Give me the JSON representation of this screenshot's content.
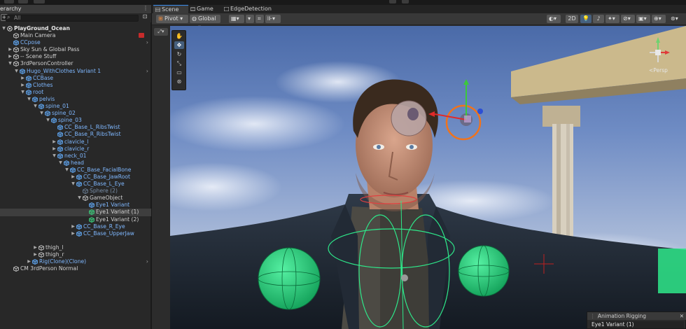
{
  "hierarchy": {
    "title": "erarchy",
    "search_placeholder": "All",
    "items": [
      {
        "label": "PlayGround_Ocean",
        "depth": 0,
        "arrow": "down",
        "kind": "scene"
      },
      {
        "label": "Main Camera",
        "depth": 1,
        "arrow": "none",
        "kind": "plain",
        "flag": true
      },
      {
        "label": "CCpose",
        "depth": 1,
        "arrow": "none",
        "kind": "blue",
        "chev": true
      },
      {
        "label": "Sky Sun & Global Pass",
        "depth": 1,
        "arrow": "right",
        "kind": "plain"
      },
      {
        "label": "-- Scene Stuff",
        "depth": 1,
        "arrow": "right",
        "kind": "plain"
      },
      {
        "label": "3rdPersonController",
        "depth": 1,
        "arrow": "down",
        "kind": "plain"
      },
      {
        "label": "Hugo_WithClothes Variant 1",
        "depth": 2,
        "arrow": "down",
        "kind": "blue",
        "chev": true
      },
      {
        "label": "CCBase",
        "depth": 3,
        "arrow": "right",
        "kind": "blue"
      },
      {
        "label": "Clothes",
        "depth": 3,
        "arrow": "right",
        "kind": "blue"
      },
      {
        "label": "root",
        "depth": 3,
        "arrow": "down",
        "kind": "blue"
      },
      {
        "label": "pelvis",
        "depth": 4,
        "arrow": "down",
        "kind": "blue"
      },
      {
        "label": "spine_01",
        "depth": 5,
        "arrow": "down",
        "kind": "blue"
      },
      {
        "label": "spine_02",
        "depth": 6,
        "arrow": "down",
        "kind": "blue"
      },
      {
        "label": "spine_03",
        "depth": 7,
        "arrow": "down",
        "kind": "blue"
      },
      {
        "label": "CC_Base_L_RibsTwist",
        "depth": 8,
        "arrow": "none",
        "kind": "blue"
      },
      {
        "label": "CC_Base_R_RibsTwist",
        "depth": 8,
        "arrow": "none",
        "kind": "blue"
      },
      {
        "label": "clavicle_l",
        "depth": 8,
        "arrow": "right",
        "kind": "blue"
      },
      {
        "label": "clavicle_r",
        "depth": 8,
        "arrow": "right",
        "kind": "blue"
      },
      {
        "label": "neck_01",
        "depth": 8,
        "arrow": "down",
        "kind": "blue"
      },
      {
        "label": "head",
        "depth": 9,
        "arrow": "down",
        "kind": "blue"
      },
      {
        "label": "CC_Base_FacialBone",
        "depth": 10,
        "arrow": "down",
        "kind": "blue"
      },
      {
        "label": "CC_Base_JawRoot",
        "depth": 11,
        "arrow": "right",
        "kind": "blue"
      },
      {
        "label": "CC_Base_L_Eye",
        "depth": 11,
        "arrow": "down",
        "kind": "blue"
      },
      {
        "label": "Sphere (2)",
        "depth": 12,
        "arrow": "none",
        "kind": "dim"
      },
      {
        "label": "GameObject",
        "depth": 12,
        "arrow": "down",
        "kind": "plain"
      },
      {
        "label": "Eye1 Variant",
        "depth": 13,
        "arrow": "none",
        "kind": "blue"
      },
      {
        "label": "Eye1 Variant (1)",
        "depth": 13,
        "arrow": "none",
        "kind": "plain",
        "selected": true,
        "green": true
      },
      {
        "label": "Eye1 Variant (2)",
        "depth": 13,
        "arrow": "none",
        "kind": "plain",
        "green": true
      },
      {
        "label": "CC_Base_R_Eye",
        "depth": 11,
        "arrow": "right",
        "kind": "blue"
      },
      {
        "label": "CC_Base_UpperJaw",
        "depth": 11,
        "arrow": "right",
        "kind": "blue"
      },
      {
        "label": "",
        "depth": 0,
        "arrow": "none",
        "kind": "spacer"
      },
      {
        "label": "thigh_l",
        "depth": 5,
        "arrow": "right",
        "kind": "plain"
      },
      {
        "label": "thigh_r",
        "depth": 5,
        "arrow": "right",
        "kind": "plain"
      },
      {
        "label": "Rig(Clone)(Clone)",
        "depth": 4,
        "arrow": "right",
        "kind": "blue",
        "chev": true
      },
      {
        "label": "CM 3rdPerson Normal",
        "depth": 1,
        "arrow": "none",
        "kind": "plain"
      }
    ]
  },
  "tabs": [
    {
      "label": "Scene",
      "active": true
    },
    {
      "label": "Game",
      "active": false
    },
    {
      "label": "EdgeDetection",
      "active": false
    }
  ],
  "toolbar": {
    "pivot": "Pivot",
    "global": "Global",
    "mode_2d": "2D"
  },
  "viewport": {
    "persp_label": "<Persp"
  },
  "animation_rigging": {
    "title": "Animation Rigging",
    "value": "Eye1 Variant (1)"
  },
  "colors": {
    "accent": "#3a8ef0",
    "selection": "#3e3e3e",
    "prefab_blue": "#7fb8ff",
    "gizmo_green": "#22d07a"
  }
}
